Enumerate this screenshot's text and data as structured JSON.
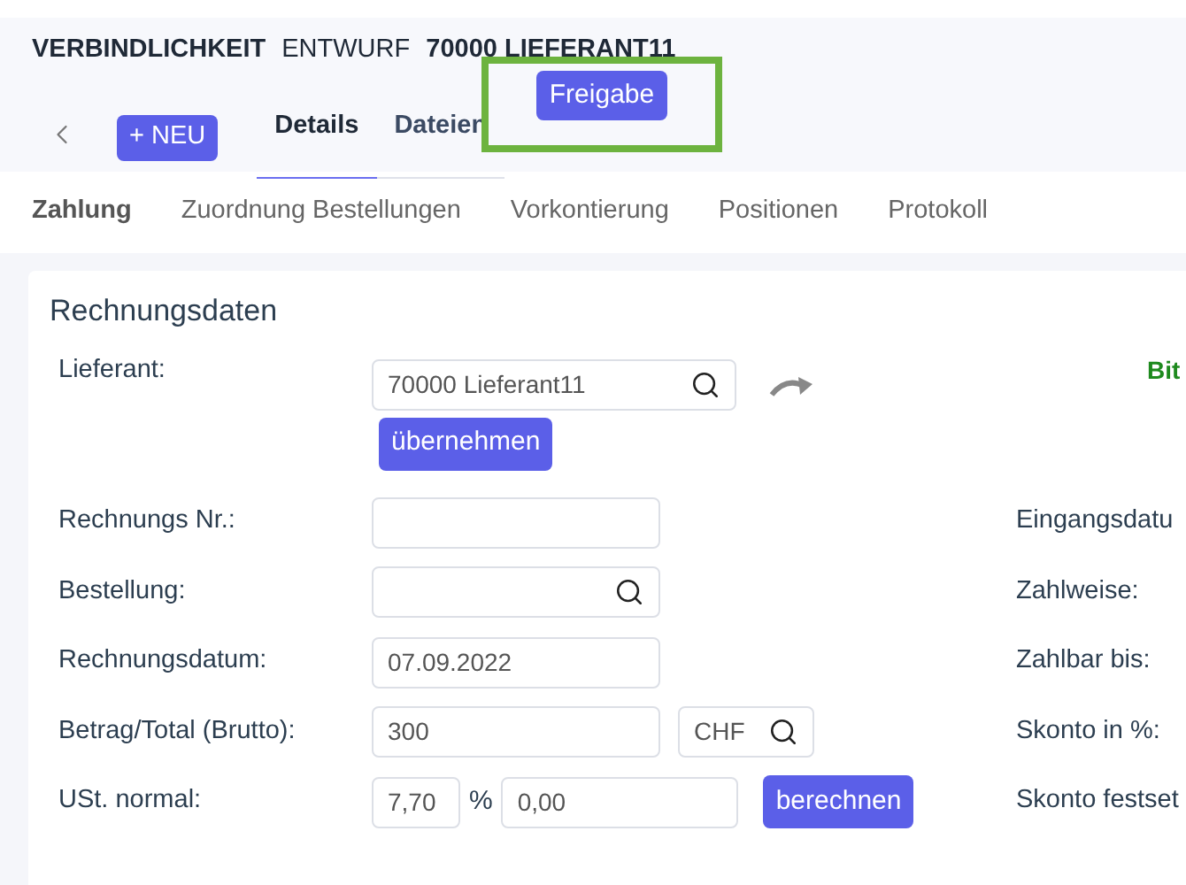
{
  "header": {
    "type": "VERBINDLICHKEIT",
    "status": "ENTWURF",
    "name": "70000 LIEFERANT11"
  },
  "new_button": "+ NEU",
  "tabs": [
    {
      "label": "Details",
      "selected": true
    },
    {
      "label": "Dateien",
      "selected": false
    }
  ],
  "highlighted_button": "Freigabe",
  "subtabs": [
    {
      "label": "Zahlung",
      "selected": true
    },
    {
      "label": "Zuordnung Bestellungen",
      "selected": false
    },
    {
      "label": "Vorkontierung",
      "selected": false
    },
    {
      "label": "Positionen",
      "selected": false
    },
    {
      "label": "Protokoll",
      "selected": false
    }
  ],
  "card": {
    "title": "Rechnungsdaten",
    "notice": "Bit",
    "supplier": {
      "label": "Lieferant:",
      "value": "70000 Lieferant11",
      "button": "übernehmen"
    },
    "rows": [
      {
        "kind": "text",
        "label": "Rechnungs Nr.:",
        "right_label": "Eingangsdatu"
      },
      {
        "kind": "search",
        "label": "Bestellung:",
        "right_label": "Zahlweise:"
      },
      {
        "kind": "text",
        "label": "Rechnungsdatum:",
        "value": "07.09.2022",
        "right_label": "Zahlbar bis:"
      },
      {
        "kind": "currency",
        "label": "Betrag/Total (Brutto):",
        "value": "300",
        "currency": "CHF",
        "right_label": "Skonto in %:"
      },
      {
        "kind": "tax",
        "label": "USt. normal:",
        "rate": "7,70",
        "unit": "%",
        "value": "0,00",
        "button": "berechnen",
        "right_label": "Skonto festset"
      }
    ]
  }
}
